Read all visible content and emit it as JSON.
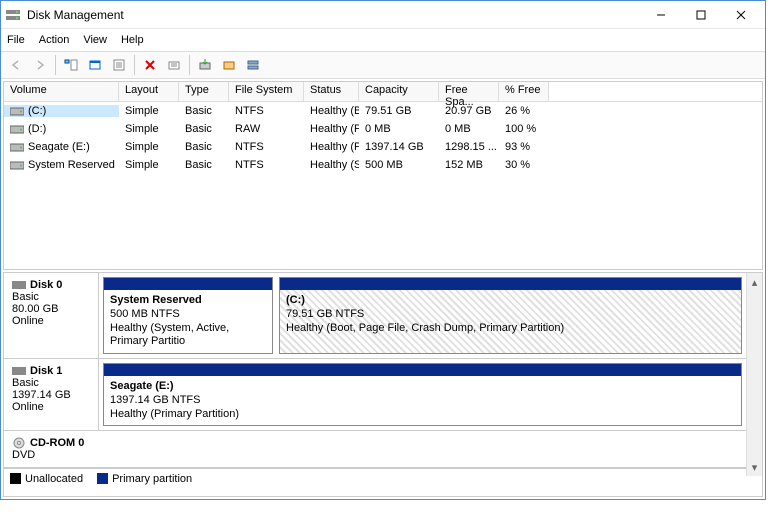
{
  "window": {
    "title": "Disk Management"
  },
  "menu": {
    "file": "File",
    "action": "Action",
    "view": "View",
    "help": "Help"
  },
  "columns": {
    "volume": "Volume",
    "layout": "Layout",
    "type": "Type",
    "fs": "File System",
    "status": "Status",
    "capacity": "Capacity",
    "free": "Free Spa...",
    "pct": "% Free"
  },
  "volumes": [
    {
      "name": "(C:)",
      "layout": "Simple",
      "type": "Basic",
      "fs": "NTFS",
      "status": "Healthy (B...",
      "capacity": "79.51 GB",
      "free": "20.97 GB",
      "pct": "26 %",
      "selected": true
    },
    {
      "name": "(D:)",
      "layout": "Simple",
      "type": "Basic",
      "fs": "RAW",
      "status": "Healthy (P...",
      "capacity": "0 MB",
      "free": "0 MB",
      "pct": "100 %",
      "selected": false
    },
    {
      "name": "Seagate (E:)",
      "layout": "Simple",
      "type": "Basic",
      "fs": "NTFS",
      "status": "Healthy (P...",
      "capacity": "1397.14 GB",
      "free": "1298.15 ...",
      "pct": "93 %",
      "selected": false
    },
    {
      "name": "System Reserved",
      "layout": "Simple",
      "type": "Basic",
      "fs": "NTFS",
      "status": "Healthy (S...",
      "capacity": "500 MB",
      "free": "152 MB",
      "pct": "30 %",
      "selected": false
    }
  ],
  "disks": {
    "d0": {
      "name": "Disk 0",
      "type": "Basic",
      "size": "80.00 GB",
      "state": "Online",
      "p0": {
        "title": "System Reserved",
        "sub": "500 MB NTFS",
        "health": "Healthy (System, Active, Primary Partitio"
      },
      "p1": {
        "title": "(C:)",
        "sub": "79.51 GB NTFS",
        "health": "Healthy (Boot, Page File, Crash Dump, Primary Partition)"
      }
    },
    "d1": {
      "name": "Disk 1",
      "type": "Basic",
      "size": "1397.14 GB",
      "state": "Online",
      "p0": {
        "title": "Seagate  (E:)",
        "sub": "1397.14 GB NTFS",
        "health": "Healthy (Primary Partition)"
      }
    },
    "cd": {
      "name": "CD-ROM 0",
      "type": "DVD"
    }
  },
  "legend": {
    "unalloc": "Unallocated",
    "primary": "Primary partition"
  }
}
